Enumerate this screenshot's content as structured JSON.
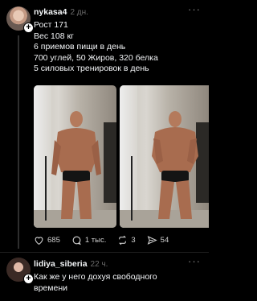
{
  "post": {
    "username": "nykasa4",
    "time": "2 дн.",
    "more_label": "···",
    "lines": [
      "Рост 171",
      "Вес 108 кг",
      "6 приемов пищи в день",
      "700 углей, 50 Жиров, 320 белка",
      "5 силовых тренировок в день"
    ],
    "likes": "685",
    "comments": "1 тыс.",
    "reposts": "3",
    "shares": "54"
  },
  "reply": {
    "username": "lidiya_siberia",
    "time": "22 ч.",
    "more_label": "···",
    "lines": [
      "Как же у него дохуя свободного",
      "времени"
    ]
  },
  "icons": {
    "like": "heart-icon",
    "comment": "comment-bubble-icon",
    "repost": "repost-arrows-icon",
    "share": "send-icon",
    "follow": "plus-icon"
  }
}
